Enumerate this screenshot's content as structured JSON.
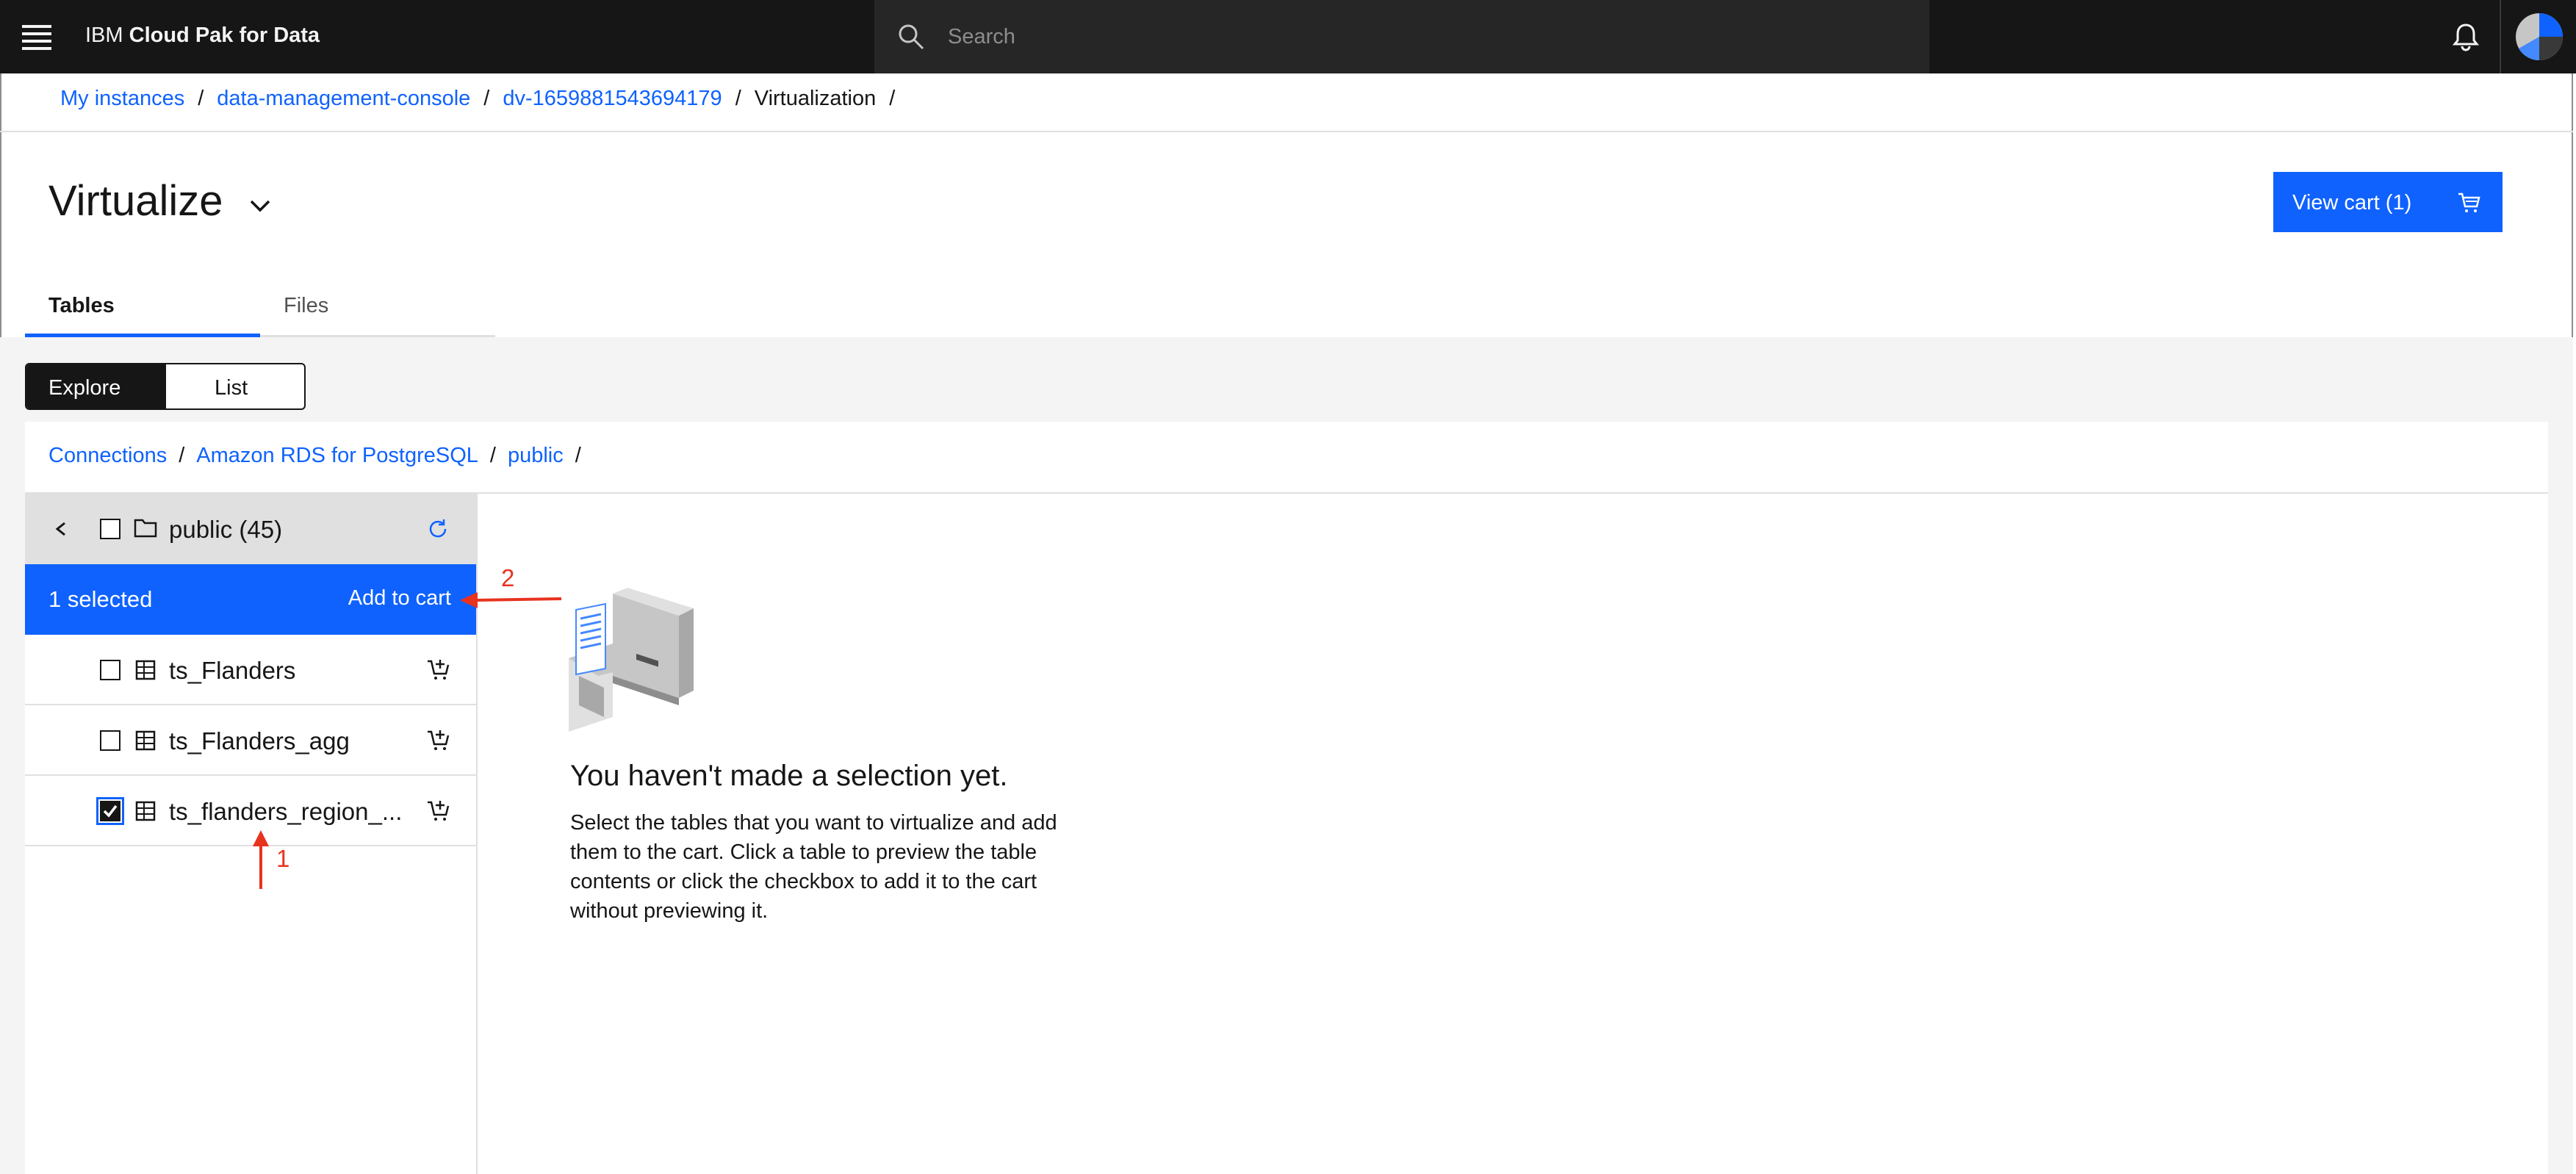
{
  "header": {
    "brand_prefix": "IBM",
    "brand_name": "Cloud Pak for Data",
    "search_placeholder": "Search"
  },
  "breadcrumb": {
    "items": [
      "My instances",
      "data-management-console",
      "dv-1659881543694179",
      "Virtualization"
    ],
    "separator": "/"
  },
  "page": {
    "title": "Virtualize",
    "cart_button": "View cart (1)"
  },
  "tabs": [
    {
      "label": "Tables",
      "active": true
    },
    {
      "label": "Files",
      "active": false
    }
  ],
  "view_toggle": {
    "options": [
      "Explore",
      "List"
    ],
    "selected": "Explore"
  },
  "connection_breadcrumb": {
    "items": [
      "Connections",
      "Amazon RDS for PostgreSQL",
      "public"
    ],
    "separator": "/"
  },
  "tree": {
    "folder_label": "public (45)",
    "selection_count": "1 selected",
    "add_to_cart": "Add to cart",
    "rows": [
      {
        "label": "ts_Flanders",
        "checked": false
      },
      {
        "label": "ts_Flanders_agg",
        "checked": false
      },
      {
        "label": "ts_flanders_region_...",
        "checked": true
      }
    ]
  },
  "empty_state": {
    "title": "You haven't made a selection yet.",
    "body": "Select the tables that you want to virtualize and add them to the cart. Click a table to preview the table contents or click the checkbox to add it to the cart without previewing it."
  },
  "annotations": [
    "1",
    "2"
  ],
  "colors": {
    "accent": "#0f62fe",
    "topbar": "#161616",
    "annotation": "#e8331f"
  }
}
